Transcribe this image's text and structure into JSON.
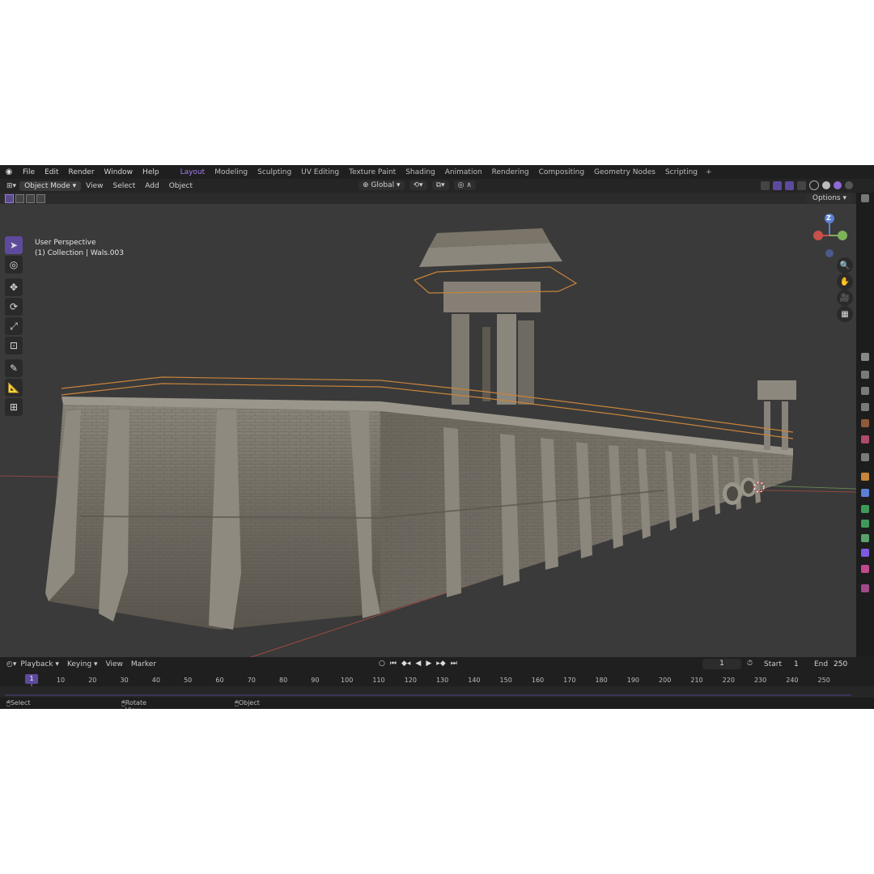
{
  "menubar": {
    "menus": [
      "File",
      "Edit",
      "Render",
      "Window",
      "Help"
    ],
    "workspaces": [
      "Layout",
      "Modeling",
      "Sculpting",
      "UV Editing",
      "Texture Paint",
      "Shading",
      "Animation",
      "Rendering",
      "Compositing",
      "Geometry Nodes",
      "Scripting"
    ],
    "active_workspace": "Layout",
    "add_label": "+"
  },
  "header": {
    "mode": "Object Mode",
    "menus": [
      "View",
      "Select",
      "Add",
      "Object"
    ],
    "transform_orientation": "Global"
  },
  "viewport": {
    "options_label": "Options",
    "perspective_label": "User Perspective",
    "collection_label": "(1) Collection | Wals.003",
    "gizmo_axis_label": "Z"
  },
  "timeline": {
    "menus": [
      "Playback",
      "Keying",
      "View",
      "Marker"
    ],
    "current_frame": "1",
    "start_label": "Start",
    "start_value": "1",
    "end_label": "End",
    "end_value": "250",
    "ruler_ticks": [
      "1",
      "10",
      "20",
      "30",
      "40",
      "50",
      "60",
      "70",
      "80",
      "90",
      "100",
      "110",
      "120",
      "130",
      "140",
      "150",
      "160",
      "170",
      "180",
      "190",
      "200",
      "210",
      "220",
      "230",
      "240",
      "250"
    ]
  },
  "statusbar": {
    "select": "Select",
    "rotate_view": "Rotate View",
    "object": "Object"
  },
  "colors": {
    "accent": "#a67cf0",
    "active_tool": "#5d4a9c",
    "railing": "#c7843a",
    "concrete": "#7c776d",
    "axis_x": "#c8504a",
    "axis_y": "#7fb05a"
  }
}
